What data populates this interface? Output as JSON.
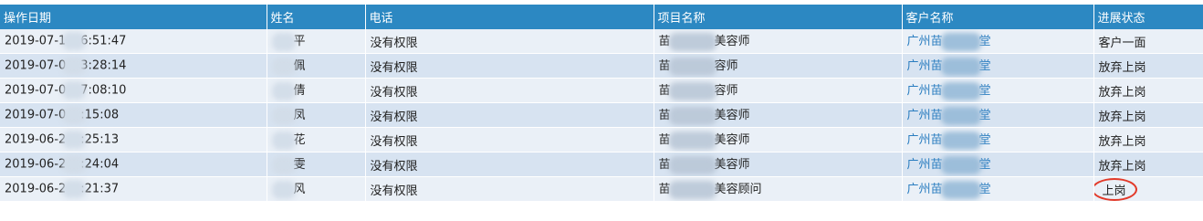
{
  "table": {
    "headers": [
      "操作日期",
      "姓名",
      "电话",
      "项目名称",
      "客户名称",
      "进展状态"
    ],
    "rows": [
      {
        "date_prefix": "2019-07-1",
        "date_suffix": "6:51:47",
        "name": "平",
        "phone": "没有权限",
        "project_prefix": "苗",
        "project_suffix": "美容师",
        "customer": "广州苗",
        "customer_suffix": "堂",
        "status": "客户一面"
      },
      {
        "date_prefix": "2019-07-0",
        "date_suffix": "3:28:14",
        "name": "佩",
        "phone": "没有权限",
        "project_prefix": "苗",
        "project_suffix": "容师",
        "customer": "广州苗",
        "customer_suffix": "堂",
        "status": "放弃上岗"
      },
      {
        "date_prefix": "2019-07-0",
        "date_suffix": "7:08:10",
        "name": "倩",
        "phone": "没有权限",
        "project_prefix": "苗",
        "project_suffix": "容师",
        "customer": "广州苗",
        "customer_suffix": "堂",
        "status": "放弃上岗"
      },
      {
        "date_prefix": "2019-07-0",
        "date_suffix": ":15:08",
        "name": "凤",
        "phone": "没有权限",
        "project_prefix": "苗",
        "project_suffix": "美容师",
        "customer": "广州苗",
        "customer_suffix": "堂",
        "status": "放弃上岗"
      },
      {
        "date_prefix": "2019-06-2",
        "date_suffix": ":25:13",
        "name": "花",
        "phone": "没有权限",
        "project_prefix": "苗",
        "project_suffix": "美容师",
        "customer": "广州苗",
        "customer_suffix": "堂",
        "status": "放弃上岗"
      },
      {
        "date_prefix": "2019-06-2",
        "date_suffix": ":24:04",
        "name": "雯",
        "phone": "没有权限",
        "project_prefix": "苗",
        "project_suffix": "美容师",
        "customer": "广州苗",
        "customer_suffix": "堂",
        "status": "放弃上岗"
      },
      {
        "date_prefix": "2019-06-2",
        "date_suffix": ":21:37",
        "name": "风",
        "phone": "没有权限",
        "project_prefix": "苗",
        "project_suffix": "美容顾问",
        "customer": "广州苗",
        "customer_suffix": "堂",
        "status": "上岗",
        "status_highlight": true
      }
    ]
  },
  "colors": {
    "header_bg": "#2c88c2",
    "row_odd": "#eaf0f7",
    "row_even": "#d7e3f1",
    "link": "#2a7dc0",
    "highlight_circle": "#e23a2a"
  }
}
